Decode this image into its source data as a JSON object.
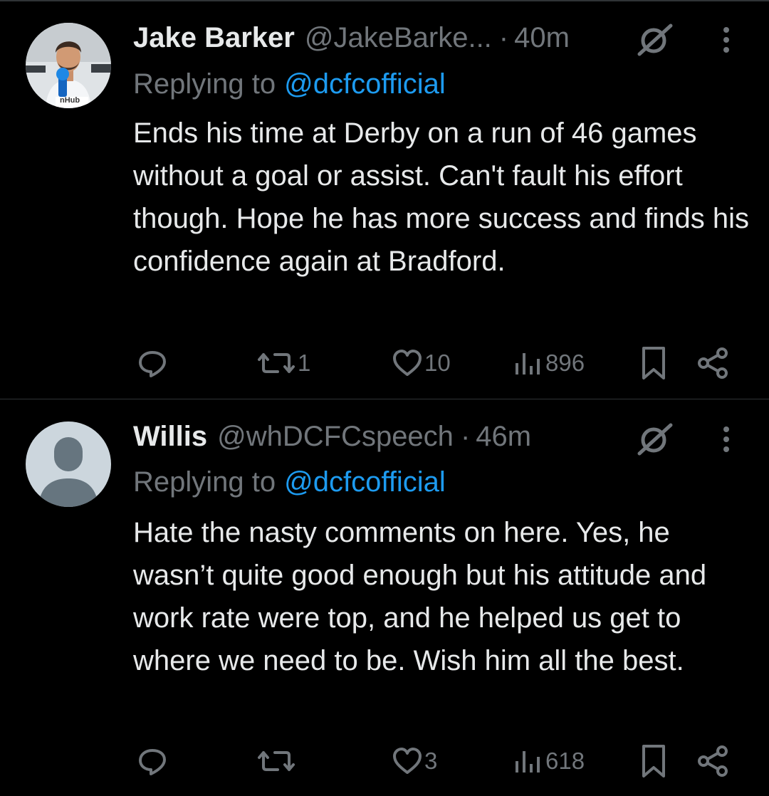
{
  "colors": {
    "background": "#000000",
    "text": "#e7e9ea",
    "muted": "#71767b",
    "link": "#1d9bf0",
    "divider": "#2f3336"
  },
  "tweets": [
    {
      "name": "Jake Barker",
      "handle": "@JakeBarke...",
      "separator": "·",
      "time": "40m",
      "replying_label": "Replying to",
      "replying_handle": "@dcfcofficial",
      "text": "Ends his time at Derby on a run of 46 games without a goal or assist. Can't fault his effort though. Hope he has more success and finds his confidence again at Bradford.",
      "avatar": "profile-photo",
      "avatar_badge": "nHub",
      "icons": [
        "reply-icon",
        "repost-icon",
        "like-icon",
        "views-icon",
        "bookmark-icon",
        "share-icon",
        "grok-icon",
        "more-icon"
      ],
      "reposts": "1",
      "likes": "10",
      "views": "896"
    },
    {
      "name": "Willis",
      "handle": "@whDCFCspeech",
      "separator": "·",
      "time": "46m",
      "replying_label": "Replying to",
      "replying_handle": "@dcfcofficial",
      "text": "Hate the nasty comments on here. Yes, he wasn’t quite good enough but his attitude and work rate were top, and he helped us get to where we need to be. Wish him all the best.",
      "avatar": "default-avatar",
      "icons": [
        "reply-icon",
        "repost-icon",
        "like-icon",
        "views-icon",
        "bookmark-icon",
        "share-icon",
        "grok-icon",
        "more-icon"
      ],
      "reposts": "",
      "likes": "3",
      "views": "618"
    }
  ]
}
